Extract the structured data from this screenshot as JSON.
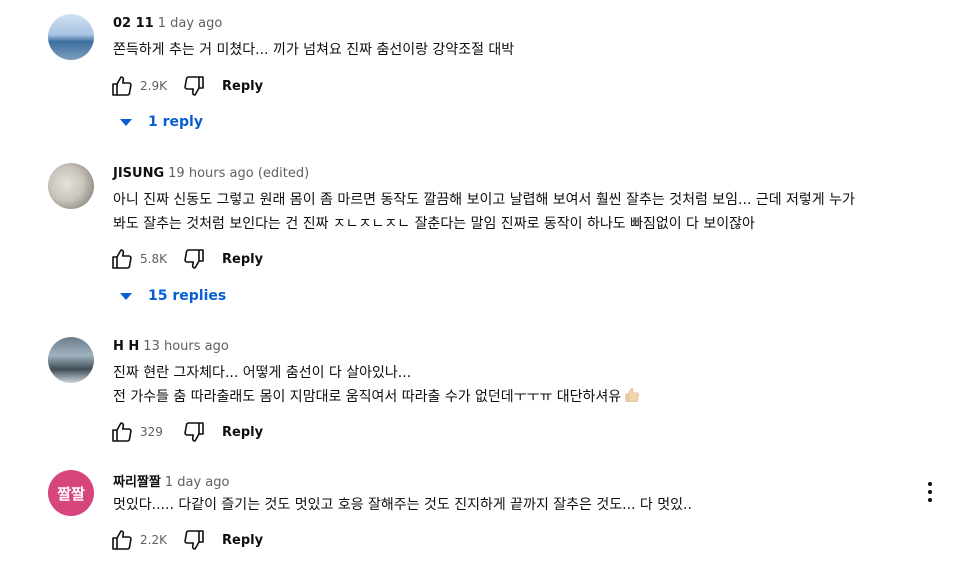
{
  "comments": [
    {
      "author": "02 11",
      "meta": "1 day ago",
      "lines": [
        "쫀득하게 추는 거 미쳤다... 끼가 넘쳐요 진짜 춤선이랑 강약조절 대박"
      ],
      "likes": "2.9K",
      "reply_label": "Reply",
      "replies_label": "1 reply"
    },
    {
      "author": "JISUNG",
      "meta": "19 hours ago (edited)",
      "lines": [
        "아니 진짜 신동도 그렇고 원래 몸이 좀 마르면 동작도 깔끔해 보이고 날렵해 보여서 훨씬 잘추는 것처럼 보임... 근데 저렇게 누가",
        "봐도 잘추는 것처럼 보인다는 건 진짜 ㅈㄴㅈㄴㅈㄴ 잘춘다는 말임 진짜로 동작이 하나도 빠짐없이 다 보이잖아"
      ],
      "likes": "5.8K",
      "reply_label": "Reply",
      "replies_label": "15 replies"
    },
    {
      "author": "H H",
      "meta": "13 hours ago",
      "lines": [
        "진짜 현란 그자체다... 어떻게 춤선이 다 살아있나...",
        "전 가수들 춤 따라출래도 몸이 지맘대로 움직여서 따라출 수가 없던데ㅜㅜㅠ 대단하셔유"
      ],
      "likes": "329",
      "reply_label": "Reply"
    },
    {
      "author": "짜리짤짤",
      "avatar_text": "짤짤",
      "meta": "1 day ago",
      "lines": [
        "멋있다..... 다같이 즐기는 것도 멋있고 호응 잘해주는 것도 진지하게 끝까지 잘추은 것도... 다 멋있.."
      ],
      "likes": "2.2K",
      "reply_label": "Reply"
    }
  ],
  "icons": {
    "like": "thumbs-up-icon",
    "dislike": "thumbs-down-icon",
    "expand": "caret-down-icon",
    "menu": "more-vertical-icon",
    "emoji": "thumbs-up-emoji"
  },
  "colors": {
    "link_blue": "#065fd4",
    "avatar_pink": "#d6457b",
    "meta_gray": "#606060"
  }
}
